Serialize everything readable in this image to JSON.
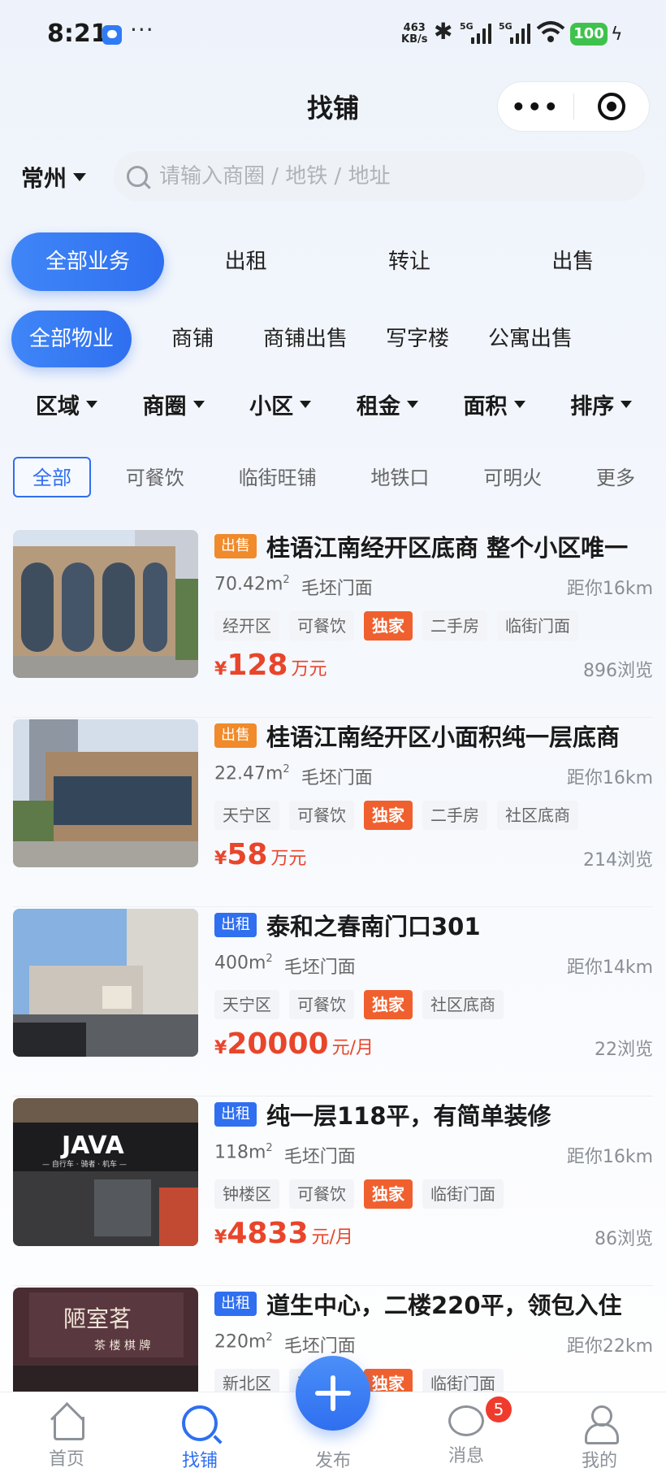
{
  "status": {
    "time": "8:21",
    "more": "···",
    "net_speed": "463",
    "net_unit": "KB/s",
    "sig1": "5G",
    "sig2": "5G",
    "battery": "100"
  },
  "nav": {
    "title": "找铺",
    "more_label": "•••"
  },
  "city": "常州",
  "search": {
    "placeholder": "请输入商圈 / 地铁 / 地址",
    "value": ""
  },
  "business_tabs": [
    "全部业务",
    "出租",
    "转让",
    "出售"
  ],
  "property_tabs": [
    "全部物业",
    "商铺",
    "商铺出售",
    "写字楼",
    "公寓出售"
  ],
  "filters": [
    "区域",
    "商圈",
    "小区",
    "租金",
    "面积",
    "排序"
  ],
  "chips": [
    "全部",
    "可餐饮",
    "临街旺铺",
    "地铁口",
    "可明火",
    "更多"
  ],
  "listings": [
    {
      "type": "出售",
      "type_kind": "sale",
      "title": "桂语江南经开区底商 整个小区唯一",
      "area": "70.42m",
      "area_sup": "2",
      "decor": "毛坯门面",
      "distance": "距你16km",
      "tags": [
        "经开区",
        "可餐饮",
        "独家",
        "二手房",
        "临街门面"
      ],
      "price_symbol": "¥",
      "price": "128",
      "price_unit": "万元",
      "views": "896浏览"
    },
    {
      "type": "出售",
      "type_kind": "sale",
      "title": "桂语江南经开区小面积纯一层底商",
      "area": "22.47m",
      "area_sup": "2",
      "decor": "毛坯门面",
      "distance": "距你16km",
      "tags": [
        "天宁区",
        "可餐饮",
        "独家",
        "二手房",
        "社区底商"
      ],
      "price_symbol": "¥",
      "price": "58",
      "price_unit": "万元",
      "views": "214浏览"
    },
    {
      "type": "出租",
      "type_kind": "rent",
      "title": "泰和之春南门口301",
      "area": "400m",
      "area_sup": "2",
      "decor": "毛坯门面",
      "distance": "距你14km",
      "tags": [
        "天宁区",
        "可餐饮",
        "独家",
        "社区底商"
      ],
      "price_symbol": "¥",
      "price": "20000",
      "price_unit": "元/月",
      "views": "22浏览"
    },
    {
      "type": "出租",
      "type_kind": "rent",
      "title": "纯一层118平，有简单装修",
      "area": "118m",
      "area_sup": "2",
      "decor": "毛坯门面",
      "distance": "距你16km",
      "tags": [
        "钟楼区",
        "可餐饮",
        "独家",
        "临街门面"
      ],
      "price_symbol": "¥",
      "price": "4833",
      "price_unit": "元/月",
      "views": "86浏览"
    },
    {
      "type": "出租",
      "type_kind": "rent",
      "title": "道生中心，二楼220平，领包入住",
      "area": "220m",
      "area_sup": "2",
      "decor": "毛坯门面",
      "distance": "距你22km",
      "tags": [
        "新北区",
        "可餐饮",
        "独家",
        "临街门面"
      ],
      "price_symbol": "¥",
      "price": "",
      "price_unit": "",
      "views": ""
    }
  ],
  "thumb_text": {
    "java": "JAVA",
    "java_sub": "— 自行车 · 骑者 · 机车 —",
    "tea": "陋室茗",
    "tea_sub": "茶 楼 棋 牌"
  },
  "tabbar": {
    "home": "首页",
    "find": "找铺",
    "publish": "发布",
    "messages": "消息",
    "mine": "我的",
    "badge": "5"
  },
  "colors": {
    "accent": "#2F6FF0",
    "price": "#E8452B",
    "sale_badge": "#F08A2A",
    "exclusive": "#F0602E"
  }
}
